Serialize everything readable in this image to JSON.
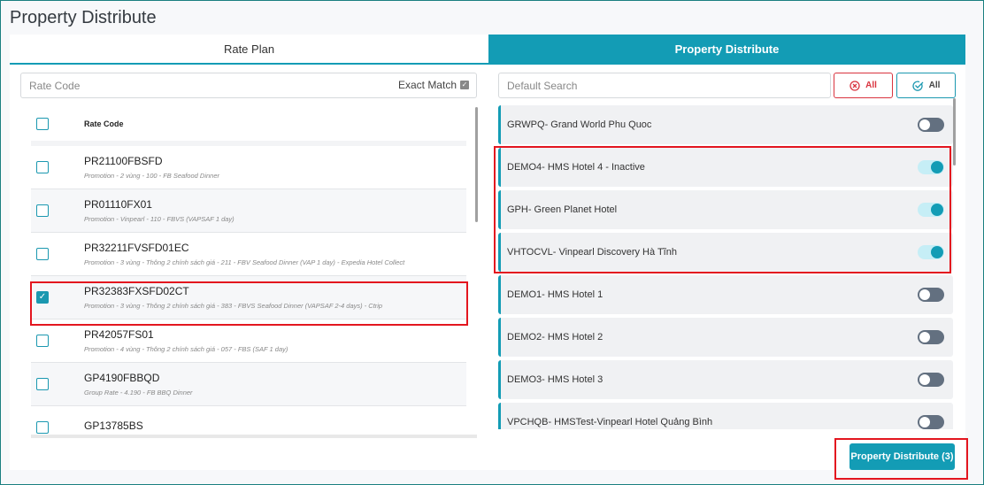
{
  "title": "Property Distribute",
  "tabs": {
    "rate_plan": "Rate Plan",
    "property_distribute": "Property Distribute"
  },
  "rate_search": {
    "placeholder": "Rate Code",
    "exact_match": "Exact Match",
    "exact_checked": true
  },
  "rate_list": {
    "header": "Rate Code",
    "rows": [
      {
        "code": "PR21100FBSFD",
        "desc": "Promotion - 2 vùng - 100 - FB Seafood Dinner",
        "checked": false
      },
      {
        "code": "PR01110FX01",
        "desc": "Promotion - Vinpearl - 110 - FBVS (VAPSAF 1 day)",
        "checked": false
      },
      {
        "code": "PR32211FVSFD01EC",
        "desc": "Promotion - 3 vùng - Thông 2 chính sách giá - 211 - FBV Seafood Dinner (VAP 1 day) - Expedia Hotel Collect",
        "checked": false
      },
      {
        "code": "PR32383FXSFD02CT",
        "desc": "Promotion - 3 vùng - Thông 2 chính sách giá - 383 - FBVS Seafood Dinner (VAPSAF 2-4 days) - Ctrip",
        "checked": true
      },
      {
        "code": "PR42057FS01",
        "desc": "Promotion - 4 vùng - Thông 2 chính sách giá - 057 - FBS (SAF 1 day)",
        "checked": false
      },
      {
        "code": "GP4190FBBQD",
        "desc": "Group Rate - 4.190 - FB BBQ Dinner",
        "checked": false
      },
      {
        "code": "GP13785BS",
        "desc": "",
        "checked": false
      }
    ]
  },
  "property_search": {
    "placeholder": "Default Search",
    "deselect_all": "All",
    "select_all": "All"
  },
  "properties": [
    {
      "label": "GRWPQ- Grand World Phu Quoc",
      "on": false
    },
    {
      "label": "DEMO4- HMS Hotel 4 - Inactive",
      "on": true
    },
    {
      "label": "GPH- Green Planet Hotel",
      "on": true
    },
    {
      "label": "VHTOCVL- Vinpearl Discovery Hà Tĩnh",
      "on": true
    },
    {
      "label": "DEMO1- HMS Hotel 1",
      "on": false
    },
    {
      "label": "DEMO2- HMS Hotel 2",
      "on": false
    },
    {
      "label": "DEMO3- HMS Hotel 3",
      "on": false
    },
    {
      "label": "VPCHQB- HMSTest-Vinpearl Hotel Quảng Bình",
      "on": false
    }
  ],
  "submit_label": "Property Distribute (3)",
  "colors": {
    "accent": "#139cb5",
    "highlight": "#e3161f",
    "danger": "#d9343f"
  }
}
